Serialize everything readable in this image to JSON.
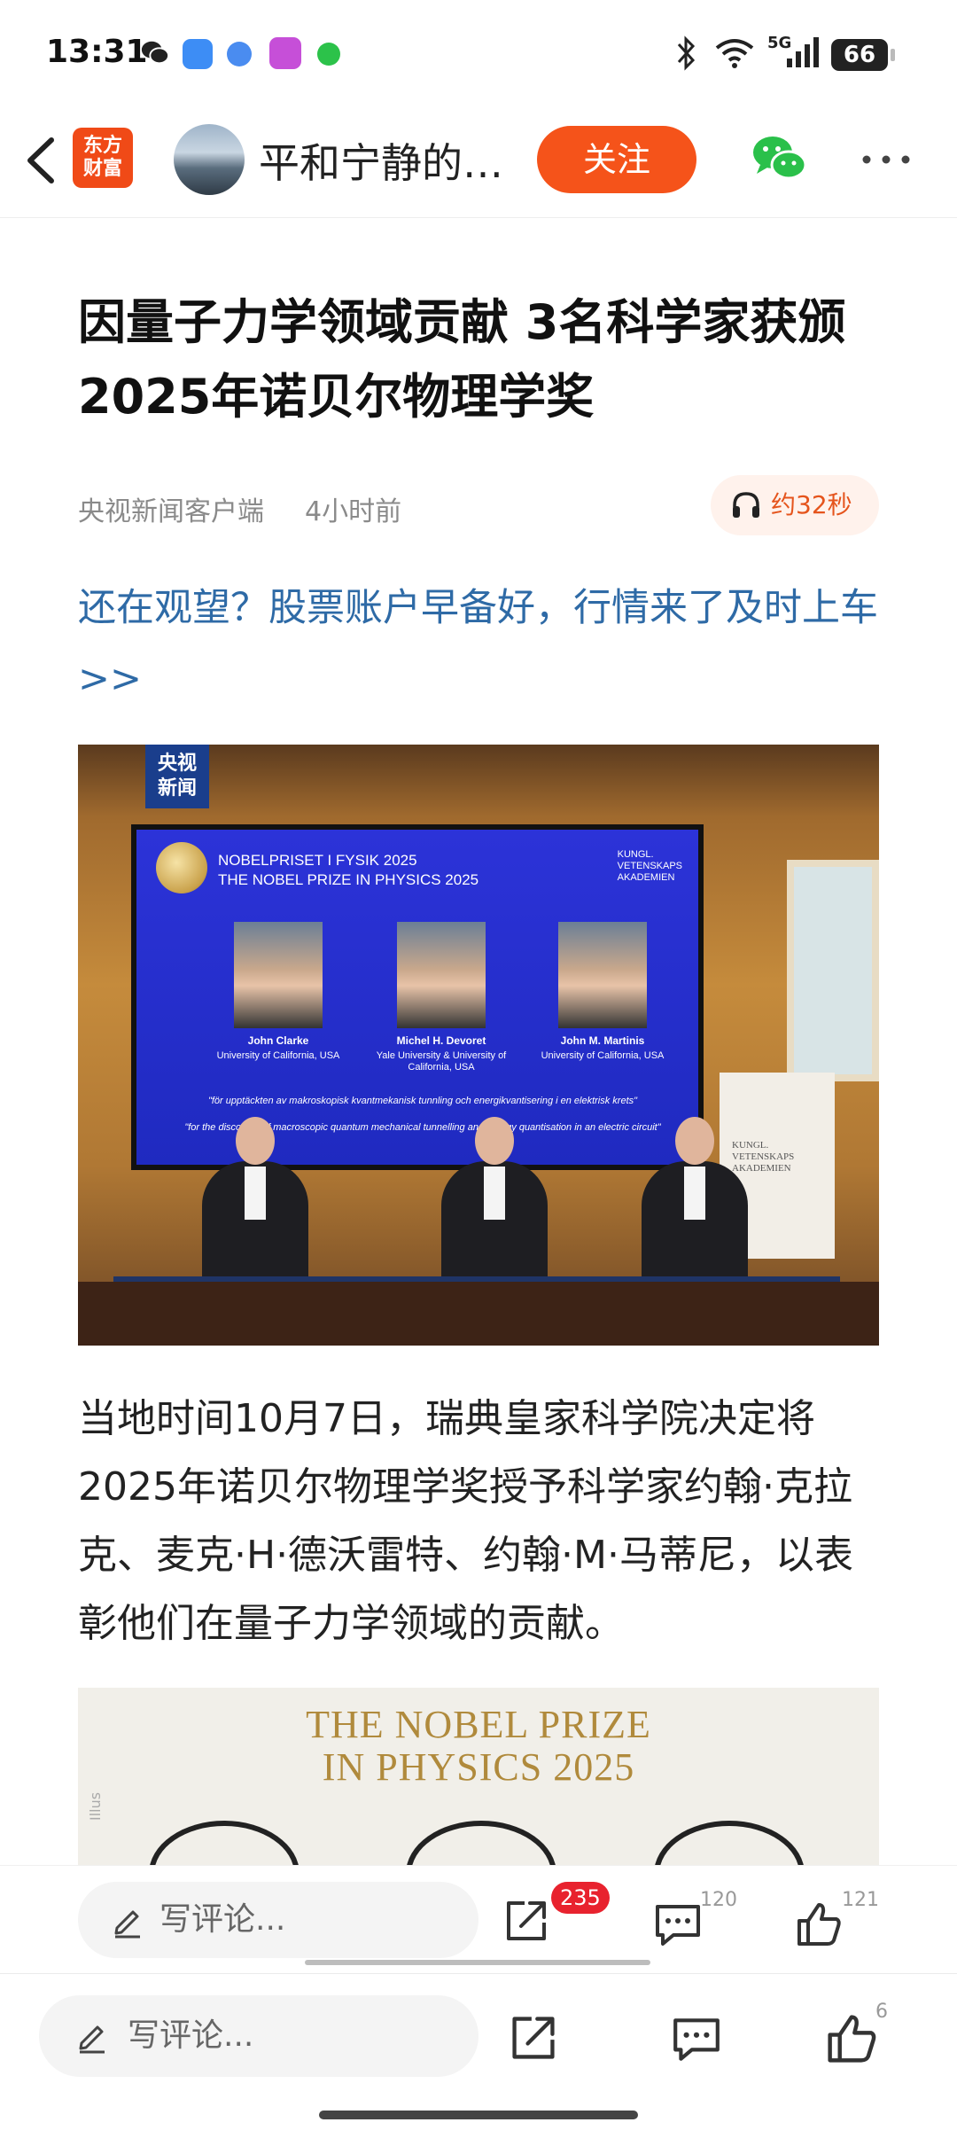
{
  "status_bar": {
    "time": "13:31",
    "network": "5G",
    "battery": "66",
    "apps": [
      "wechat-icon",
      "blue-app-icon",
      "browser-icon",
      "bank-app-icon",
      "chat-icon"
    ]
  },
  "nav": {
    "logo_line1": "东方",
    "logo_line2": "财富",
    "author": "平和宁静的…",
    "follow": "关注"
  },
  "article": {
    "title": "因量子力学领域贡献 3名科学家获颁2025年诺贝尔物理学奖",
    "source": "央视新闻客户端",
    "time_ago": "4小时前",
    "audio": "约32秒",
    "promo": "还在观望？股票账户早备好，行情来了及时上车>>",
    "body": "当地时间10月7日，瑞典皇家科学院决定将2025年诺贝尔物理学奖授予科学家约翰·克拉克、麦克·H·德沃雷特、约翰·M·马蒂尼，以表彰他们在量子力学领域的贡献。"
  },
  "photo1": {
    "watermark_line1": "央视",
    "watermark_line2": "新闻",
    "screen_title_line1": "NOBELPRISET I FYSIK 2025",
    "screen_title_line2": "THE NOBEL PRIZE IN PHYSICS 2025",
    "academy_line1": "KUNGL.",
    "academy_line2": "VETENSKAPS",
    "academy_line3": "AKADEMIEN",
    "winners": [
      {
        "name": "John Clarke",
        "affiliation": "University of California, USA"
      },
      {
        "name": "Michel H. Devoret",
        "affiliation": "Yale University & University of California, USA"
      },
      {
        "name": "John M. Martinis",
        "affiliation": "University of California, USA"
      }
    ],
    "citation_sv": "\"för upptäckten av makroskopisk kvantmekanisk tunnling och energikvantisering i en elektrisk krets\"",
    "citation_en": "\"for the discovery of macroscopic quantum mechanical tunnelling and energy quantisation in an electric circuit\""
  },
  "photo2": {
    "title_line1": "THE NOBEL PRIZE",
    "title_line2": "IN PHYSICS 2025",
    "side_text": "Illus"
  },
  "bottom_bar_1": {
    "placeholder": "写评论...",
    "share_badge": "235",
    "comment_count": "120",
    "like_count": "121"
  },
  "bottom_bar_2": {
    "placeholder": "写评论...",
    "like_count": "6"
  },
  "colors": {
    "accent": "#f5531a",
    "link": "#2e6aa6",
    "badge": "#e8222e"
  }
}
